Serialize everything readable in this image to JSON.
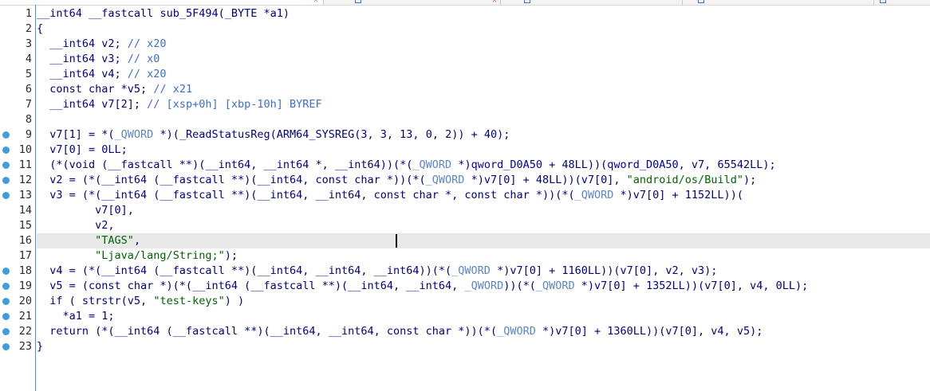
{
  "editor": {
    "lines": [
      {
        "num": "1",
        "dot": false,
        "tokens": [
          {
            "t": "__int64 __fastcall ",
            "c": "c"
          },
          {
            "t": "sub_5F494",
            "c": "c"
          },
          {
            "t": "(_BYTE *a1)",
            "c": "c"
          }
        ]
      },
      {
        "num": "2",
        "dot": false,
        "tokens": [
          {
            "t": "{",
            "c": "c"
          }
        ]
      },
      {
        "num": "3",
        "dot": false,
        "tokens": [
          {
            "t": "  __int64 v2; ",
            "c": "c"
          },
          {
            "t": "// x20",
            "c": "cm"
          }
        ]
      },
      {
        "num": "4",
        "dot": false,
        "tokens": [
          {
            "t": "  __int64 v3; ",
            "c": "c"
          },
          {
            "t": "// x0",
            "c": "cm"
          }
        ]
      },
      {
        "num": "5",
        "dot": false,
        "tokens": [
          {
            "t": "  __int64 v4; ",
            "c": "c"
          },
          {
            "t": "// x20",
            "c": "cm"
          }
        ]
      },
      {
        "num": "6",
        "dot": false,
        "tokens": [
          {
            "t": "  const char *v5; ",
            "c": "c"
          },
          {
            "t": "// x21",
            "c": "cm"
          }
        ]
      },
      {
        "num": "7",
        "dot": false,
        "tokens": [
          {
            "t": "  __int64 v7[2]; ",
            "c": "c"
          },
          {
            "t": "// [xsp+0h] [xbp-10h] BYREF",
            "c": "cm"
          }
        ]
      },
      {
        "num": "8",
        "dot": false,
        "tokens": [
          {
            "t": "",
            "c": "c"
          }
        ]
      },
      {
        "num": "9",
        "dot": true,
        "tokens": [
          {
            "t": "  v7[1] = *(",
            "c": "c"
          },
          {
            "t": "_QWORD",
            "c": "k"
          },
          {
            "t": " *)(_ReadStatusReg(ARM64_SYSREG(3, 3, 13, 0, 2)) + 40);",
            "c": "c"
          }
        ]
      },
      {
        "num": "10",
        "dot": true,
        "tokens": [
          {
            "t": "  v7[0] = 0LL;",
            "c": "c"
          }
        ]
      },
      {
        "num": "11",
        "dot": true,
        "tokens": [
          {
            "t": "  (*(void (__fastcall **)(__int64, __int64 *, __int64))(*(",
            "c": "c"
          },
          {
            "t": "_QWORD",
            "c": "k"
          },
          {
            "t": " *)",
            "c": "c"
          },
          {
            "t": "qword_D0A50",
            "c": "g"
          },
          {
            "t": " + 48LL))(",
            "c": "c"
          },
          {
            "t": "qword_D0A50",
            "c": "g"
          },
          {
            "t": ", v7, 65542LL);",
            "c": "c"
          }
        ]
      },
      {
        "num": "12",
        "dot": true,
        "tokens": [
          {
            "t": "  v2 = (*(__int64 (__fastcall **)(__int64, const char *))(*(",
            "c": "c"
          },
          {
            "t": "_QWORD",
            "c": "k"
          },
          {
            "t": " *)v7[0] + 48LL))(v7[0], ",
            "c": "c"
          },
          {
            "t": "\"android/os/Build\"",
            "c": "s"
          },
          {
            "t": ");",
            "c": "c"
          }
        ]
      },
      {
        "num": "13",
        "dot": true,
        "tokens": [
          {
            "t": "  v3 = (*(__int64 (__fastcall **)(__int64, __int64, const char *, const char *))(*(",
            "c": "c"
          },
          {
            "t": "_QWORD",
            "c": "k"
          },
          {
            "t": " *)v7[0] + 1152LL))(",
            "c": "c"
          }
        ]
      },
      {
        "num": "14",
        "dot": false,
        "tokens": [
          {
            "t": "         v7[0],",
            "c": "c"
          }
        ]
      },
      {
        "num": "15",
        "dot": false,
        "tokens": [
          {
            "t": "         v2,",
            "c": "c"
          }
        ]
      },
      {
        "num": "16",
        "dot": false,
        "current": true,
        "tokens": [
          {
            "t": "         ",
            "c": "c"
          },
          {
            "t": "\"TAGS\"",
            "c": "s"
          },
          {
            "t": ",",
            "c": "c"
          }
        ]
      },
      {
        "num": "17",
        "dot": false,
        "tokens": [
          {
            "t": "         ",
            "c": "c"
          },
          {
            "t": "\"Ljava/lang/String;\"",
            "c": "s"
          },
          {
            "t": ");",
            "c": "c"
          }
        ]
      },
      {
        "num": "18",
        "dot": true,
        "tokens": [
          {
            "t": "  v4 = (*(__int64 (__fastcall **)(__int64, __int64, __int64))(*(",
            "c": "c"
          },
          {
            "t": "_QWORD",
            "c": "k"
          },
          {
            "t": " *)v7[0] + 1160LL))(v7[0], v2, v3);",
            "c": "c"
          }
        ]
      },
      {
        "num": "19",
        "dot": true,
        "tokens": [
          {
            "t": "  v5 = (const char *)(*(__int64 (__fastcall **)(__int64, __int64, ",
            "c": "c"
          },
          {
            "t": "_QWORD",
            "c": "k"
          },
          {
            "t": "))(*(",
            "c": "c"
          },
          {
            "t": "_QWORD",
            "c": "k"
          },
          {
            "t": " *)v7[0] + 1352LL))(v7[0], v4, 0LL);",
            "c": "c"
          }
        ]
      },
      {
        "num": "20",
        "dot": true,
        "tokens": [
          {
            "t": "  if ( strstr(v5, ",
            "c": "c"
          },
          {
            "t": "\"test-keys\"",
            "c": "s"
          },
          {
            "t": ") )",
            "c": "c"
          }
        ]
      },
      {
        "num": "21",
        "dot": true,
        "tokens": [
          {
            "t": "    *a1 = 1;",
            "c": "c"
          }
        ]
      },
      {
        "num": "22",
        "dot": true,
        "tokens": [
          {
            "t": "  return (*(__int64 (__fastcall **)(__int64, __int64, const char *))(*(",
            "c": "c"
          },
          {
            "t": "_QWORD",
            "c": "k"
          },
          {
            "t": " *)v7[0] + 1360LL))(v7[0], v4, v5);",
            "c": "c"
          }
        ]
      },
      {
        "num": "23",
        "dot": true,
        "tokens": [
          {
            "t": "}",
            "c": "c"
          }
        ]
      }
    ]
  },
  "colors": {
    "breakpoint_dot": "#3f9ce0",
    "gutter_border": "#4a8fd8",
    "string": "#006400",
    "comment": "#3d6ed0",
    "keyword": "#5b86c8",
    "global": "#0000a0",
    "code": "#000080",
    "current_line": "#e8e8e8"
  }
}
